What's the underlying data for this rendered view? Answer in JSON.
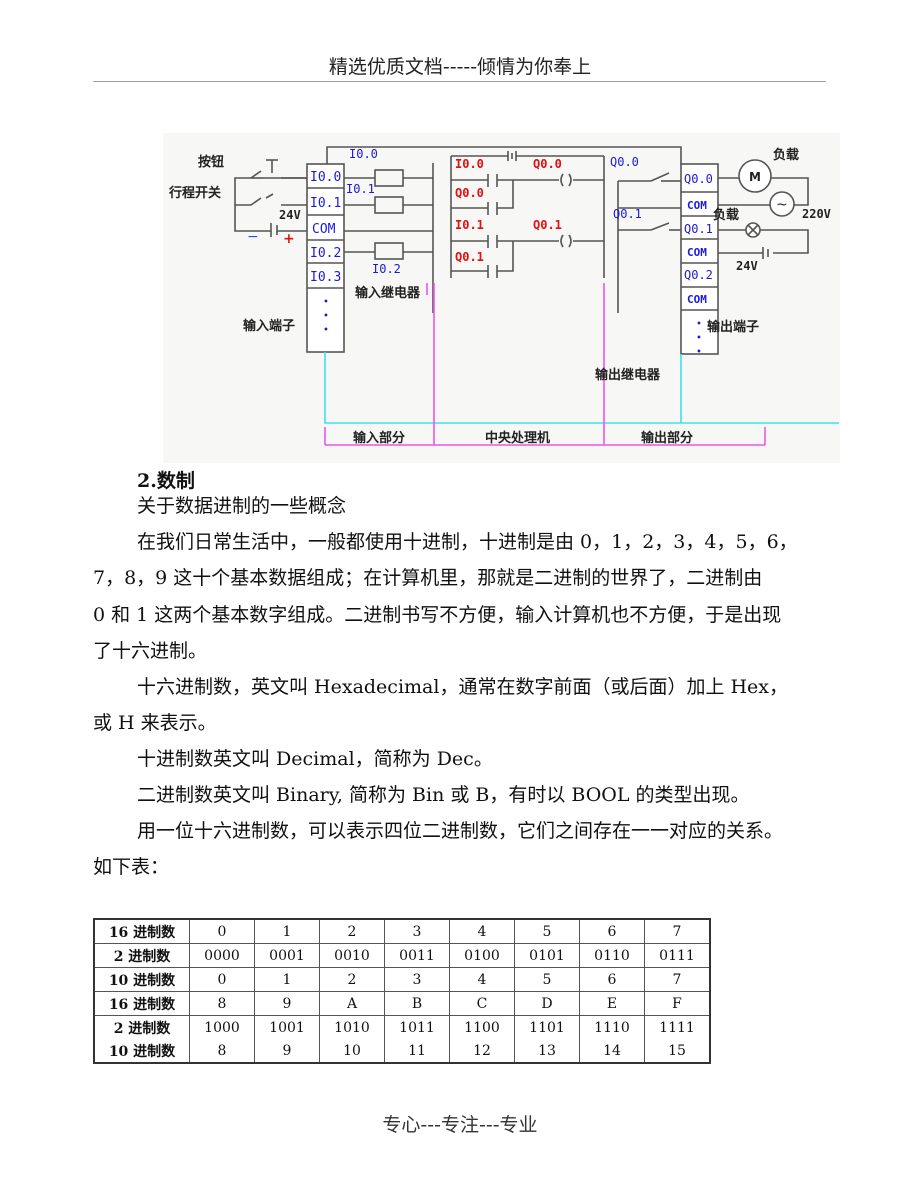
{
  "header": {
    "text": "精选优质文档-----倾情为你奉上"
  },
  "footer": {
    "text": "专心---专注---专业"
  },
  "diagram": {
    "left_labels": {
      "button": "按钮",
      "limit_switch": "行程开关",
      "voltage": "24V",
      "minus": "−",
      "plus": "+",
      "input_terminal": "输入端子"
    },
    "input_terminals": [
      "I0.0",
      "I0.1",
      "COM",
      "I0.2",
      "I0.3"
    ],
    "input_relays": [
      "I0.0",
      "I0.1",
      "I0.2"
    ],
    "input_relay_label": "输入继电器",
    "ladder": {
      "rungs": [
        {
          "contact": "I0.0",
          "hold": "Q0.0",
          "coil": "Q0.0"
        },
        {
          "contact": "I0.1",
          "hold": "Q0.1",
          "coil": "Q0.1"
        }
      ]
    },
    "output_contacts": [
      "Q0.0",
      "Q0.1"
    ],
    "output_terminals": [
      "Q0.0",
      "COM",
      "Q0.1",
      "COM",
      "Q0.2",
      "COM"
    ],
    "output_labels": {
      "load1": "负载",
      "motor": "M",
      "ac": "~",
      "ac_voltage": "220V",
      "load2": "负载",
      "dc_voltage": "24V",
      "output_terminal": "输出端子",
      "output_relay": "输出继电器"
    },
    "sections": [
      "输入部分",
      "中央处理机",
      "输出部分"
    ],
    "colors": {
      "terminal_text": "#1a1adc",
      "ladder_text": "#e01010",
      "cyan": "#3fe0ee",
      "magenta": "#ee55ee",
      "wire": "#555555"
    }
  },
  "body": {
    "section_title": "2.数制",
    "subtitle": "关于数据进制的一些概念",
    "para1": [
      "在我们日常生活中，一般都使用十进制，十进制是由 0，1，2，3，4，5，6，",
      "7，8，9 这十个基本数据组成；在计算机里，那就是二进制的世界了，二进制由",
      "0 和 1 这两个基本数字组成。二进制书写不方便，输入计算机也不方便，于是出现",
      "了十六进制。"
    ],
    "para2": [
      "十六进制数，英文叫 Hexadecimal，通常在数字前面（或后面）加上 Hex，",
      "或 H 来表示。"
    ],
    "para3": "十进制数英文叫 Decimal，简称为 Dec。",
    "para4": "二进制数英文叫 Binary, 简称为 Bin 或 B，有时以 BOOL 的类型出现。",
    "para5": [
      "用一位十六进制数，可以表示四位二进制数，它们之间存在一一对应的关系。",
      "如下表："
    ]
  },
  "table": {
    "rows": [
      {
        "header": "16 进制数",
        "cells": [
          "0",
          "1",
          "2",
          "3",
          "4",
          "5",
          "6",
          "7"
        ]
      },
      {
        "header": "2 进制数",
        "cells": [
          "0000",
          "0001",
          "0010",
          "0011",
          "0100",
          "0101",
          "0110",
          "0111"
        ]
      },
      {
        "header": "10 进制数",
        "cells": [
          "0",
          "1",
          "2",
          "3",
          "4",
          "5",
          "6",
          "7"
        ]
      },
      {
        "header": "16 进制数",
        "cells": [
          "8",
          "9",
          "A",
          "B",
          "C",
          "D",
          "E",
          "F"
        ]
      },
      {
        "header": "2 进制数",
        "cells": [
          "1000",
          "1001",
          "1010",
          "1011",
          "1100",
          "1101",
          "1110",
          "1111"
        ]
      },
      {
        "header": "10 进制数",
        "cells": [
          "8",
          "9",
          "10",
          "11",
          "12",
          "13",
          "14",
          "15"
        ]
      }
    ]
  }
}
